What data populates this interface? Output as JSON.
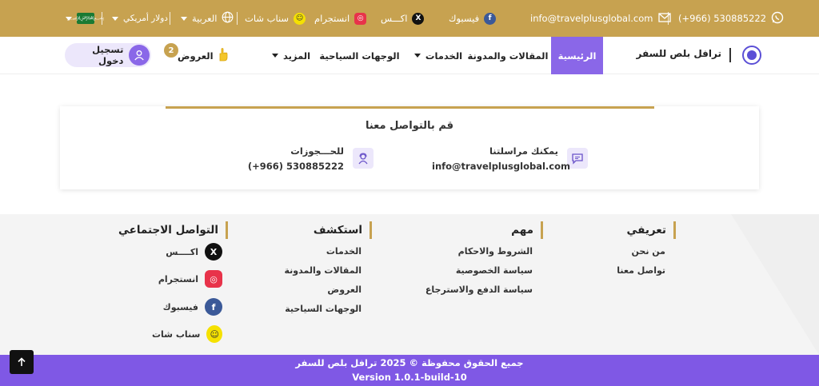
{
  "topbar": {
    "phone": "(+966) 530885222",
    "email": "info@travelplusglobal.com",
    "facebook": "فيسبوك",
    "x": "اكـــس",
    "instagram": "انستجرام",
    "snapchat": "سناب شات",
    "language": "العربية",
    "currency": "دولار أمريكي"
  },
  "nav": {
    "brand": "ترافل بلص للسفر",
    "items": [
      {
        "label": "الرئيسية"
      },
      {
        "label": "المقالات والمدونة"
      },
      {
        "label": "الخدمات"
      },
      {
        "label": "الوجهات السياحية"
      },
      {
        "label": "المزيد"
      }
    ],
    "offers_label": "العروض",
    "offers_count": "2",
    "login_label": "تسجيل دخول"
  },
  "contact": {
    "title": "قم بالتواصل معنا",
    "message_label": "يمكنك مراسلتنا",
    "message_value": "info@travelplusglobal.com",
    "booking_label": "للحـــجوزات",
    "booking_value": "(+966) 530885222"
  },
  "footer": {
    "columns": [
      {
        "title": "تعريفي",
        "links": [
          "من نحن",
          "تواصل معنا"
        ]
      },
      {
        "title": "مهم",
        "links": [
          "الشروط والاحكام",
          "سياسة الخصوصية",
          "سياسة الدفع والاسترجاع"
        ]
      },
      {
        "title": "استكشف",
        "links": [
          "الخدمات",
          "المقالات والمدونة",
          "العروض",
          "الوجهات السياحية"
        ]
      }
    ],
    "social_title": "التواصل الاجتماعي",
    "social": [
      {
        "label": "اكــــس",
        "icon": "x-icon",
        "color": "#111111"
      },
      {
        "label": "انستجرام",
        "icon": "instagram-icon",
        "color": "#e8334a"
      },
      {
        "label": "فيسبوك",
        "icon": "facebook-icon",
        "color": "#3b5998"
      },
      {
        "label": "سناب شات",
        "icon": "snapchat-icon",
        "color": "#f5e100"
      }
    ]
  },
  "bottom": {
    "copyright": "جميع الحقوق محفوظة © 2025 ترافل بلص للسفر",
    "version": "Version 1.0.1-build-10"
  },
  "colors": {
    "gold": "#c7a250",
    "purple": "#7f58e5",
    "nav_active": "#8a67e8"
  }
}
